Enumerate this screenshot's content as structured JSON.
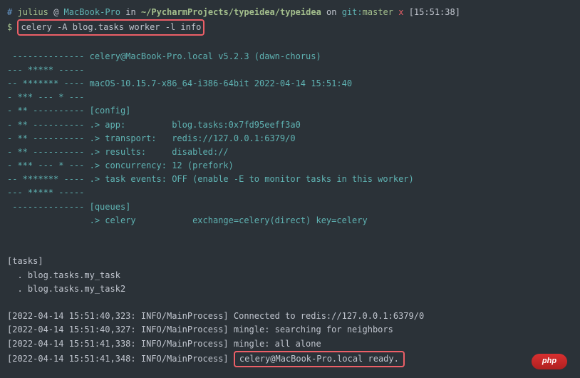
{
  "prompt": {
    "hash": "#",
    "user": "julius",
    "at": "@",
    "host": "MacBook-Pro",
    "in": "in",
    "path": "~/PycharmProjects/typeidea/typeidea",
    "on": "on",
    "git": "git:",
    "branch": "master",
    "x": "x",
    "time": "[15:51:38]",
    "dollar": "$",
    "command": "celery -A blog.tasks worker -l info"
  },
  "banner": {
    "l1a": " -------------- ",
    "l1b": "celery@MacBook-Pro.local v5.2.3 (dawn-chorus)",
    "l2": "--- ***** -----",
    "l3a": "-- ******* ---- ",
    "l3b": "macOS-10.15.7-x86_64-i386-64bit 2022-04-14 15:51:40",
    "l4": "- *** --- * ---",
    "l5a": "- ** ---------- ",
    "l5b": "[config]",
    "l6a": "- ** ---------- ",
    "l6b": ".> app:         blog.tasks:0x7fd95eeff3a0",
    "l7a": "- ** ---------- ",
    "l7b": ".> transport:   redis://127.0.0.1:6379/0",
    "l8a": "- ** ---------- ",
    "l8b": ".> results:     disabled://",
    "l9a": "- *** --- * --- ",
    "l9b": ".> concurrency: 12 (prefork)",
    "l10a": "-- ******* ---- ",
    "l10b": ".> task events: OFF (enable -E to monitor tasks in this worker)",
    "l11": "--- ***** -----",
    "l12a": " -------------- ",
    "l12b": "[queues]",
    "l13": "                .> celery           exchange=celery(direct) key=celery"
  },
  "tasks": {
    "header": "[tasks]",
    "t1": "  . blog.tasks.my_task",
    "t2": "  . blog.tasks.my_task2"
  },
  "logs": {
    "l1": "[2022-04-14 15:51:40,323: INFO/MainProcess] Connected to redis://127.0.0.1:6379/0",
    "l2": "[2022-04-14 15:51:40,327: INFO/MainProcess] mingle: searching for neighbors",
    "l3": "[2022-04-14 15:51:41,338: INFO/MainProcess] mingle: all alone",
    "l4a": "[2022-04-14 15:51:41,348: INFO/MainProcess] ",
    "l4b": "celery@MacBook-Pro.local ready."
  },
  "watermark": {
    "main": "php",
    "sub": ""
  }
}
